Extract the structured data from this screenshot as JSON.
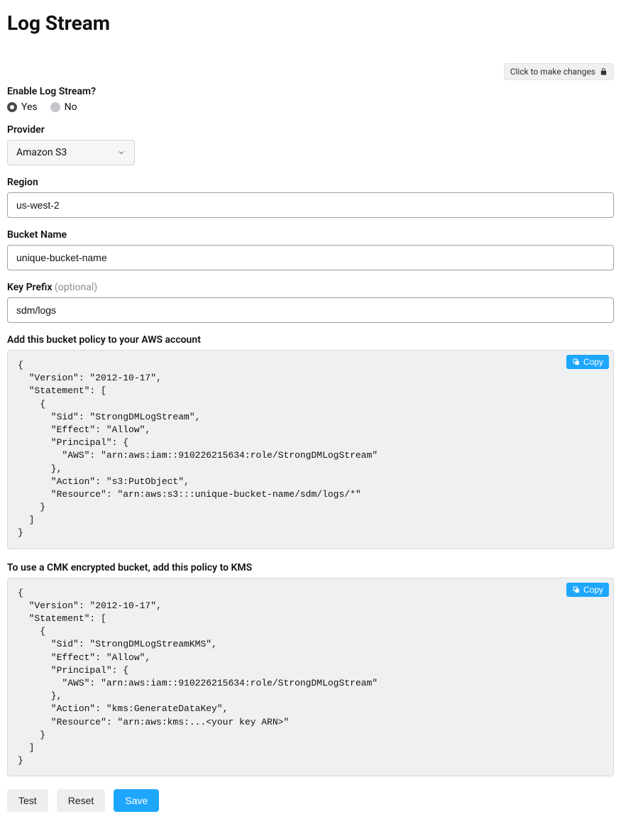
{
  "page_title": "Log Stream",
  "lock_pill": "Click to make changes",
  "enable_label": "Enable Log Stream?",
  "enable_options": {
    "yes": "Yes",
    "no": "No"
  },
  "provider": {
    "label": "Provider",
    "value": "Amazon S3"
  },
  "region": {
    "label": "Region",
    "value": "us-west-2"
  },
  "bucket_name": {
    "label": "Bucket Name",
    "value": "unique-bucket-name"
  },
  "key_prefix": {
    "label": "Key Prefix",
    "optional": "(optional)",
    "value": "sdm/logs"
  },
  "copy_label": "Copy",
  "policy1": {
    "label": "Add this bucket policy to your AWS account",
    "code": "{\n  \"Version\": \"2012-10-17\",\n  \"Statement\": [\n    {\n      \"Sid\": \"StrongDMLogStream\",\n      \"Effect\": \"Allow\",\n      \"Principal\": {\n        \"AWS\": \"arn:aws:iam::910226215634:role/StrongDMLogStream\"\n      },\n      \"Action\": \"s3:PutObject\",\n      \"Resource\": \"arn:aws:s3:::unique-bucket-name/sdm/logs/*\"\n    }\n  ]\n}"
  },
  "policy2": {
    "label": "To use a CMK encrypted bucket, add this policy to KMS",
    "code": "{\n  \"Version\": \"2012-10-17\",\n  \"Statement\": [\n    {\n      \"Sid\": \"StrongDMLogStreamKMS\",\n      \"Effect\": \"Allow\",\n      \"Principal\": {\n        \"AWS\": \"arn:aws:iam::910226215634:role/StrongDMLogStream\"\n      },\n      \"Action\": \"kms:GenerateDataKey\",\n      \"Resource\": \"arn:aws:kms:...<your key ARN>\"\n    }\n  ]\n}"
  },
  "actions": {
    "test": "Test",
    "reset": "Reset",
    "save": "Save"
  }
}
